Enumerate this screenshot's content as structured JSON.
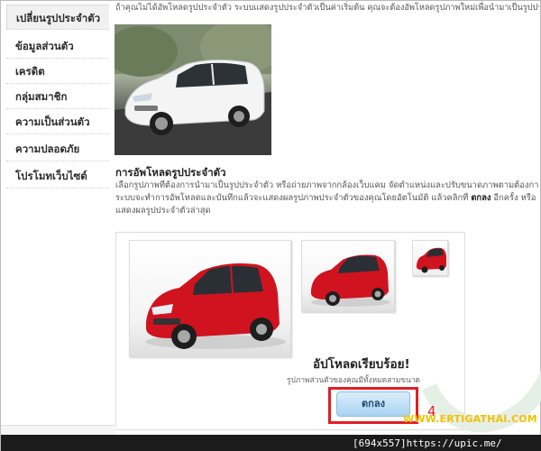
{
  "sidebar": {
    "items": [
      {
        "label": "เปลี่ยนรูปประจำตัว",
        "active": true
      },
      {
        "label": "ข้อมูลส่วนตัว"
      },
      {
        "label": "เครดิต"
      },
      {
        "label": "กลุ่มสมาชิก"
      },
      {
        "label": "ความเป็นส่วนตัว"
      },
      {
        "label": "ความปลอดภัย"
      },
      {
        "label": "โปรโมทเว็บไซต์"
      }
    ]
  },
  "intro": {
    "text": "ถ้าคุณไม่ได้อัพโหลดรูปประจำตัว ระบบแสดงรูปประจำตัวเป็นค่าเริ่มต้น คุณจะต้องอัพโหลดรูปภาพใหม่เพื่อนำมาเป็นรูปประจำตัว"
  },
  "upload": {
    "title": "การอัพโหลดรูปประจำตัว",
    "desc_line1": "เลือกรูปภาพที่ต้องการนำมาเป็นรูปประจำตัว หรือถ่ายภาพจากกล้องเว็บแคม จัดตำแหน่งและปรับขนาดภาพตามต้องการ",
    "desc_line2_pre": "ระบบจะทำการอัพโหลดและบันทึกแล้วจะแสดงผลรูปภาพประจำตัวของคุณโดยอัตโนมัติ แล้วคลิกที่ ",
    "desc_ok_word": "ตกลง",
    "desc_line2_post": " อีกครั้ง หรือ",
    "desc_line3": "แสดงผลรูปประจำตัวล่าสุด"
  },
  "result": {
    "title": "อัปโหลดเรียบร้อย!",
    "subtitle": "รูปภาพส่วนตัวของคุณมีทั้งหมดสามขนาด",
    "ok_label": "ตกลง"
  },
  "annotation": {
    "step_number": "4",
    "watermark": "WWW.ERTIGATHAI.COM"
  },
  "footer": {
    "upic_text": "[694x557]https://upic.me/"
  },
  "colors": {
    "highlight_red": "#e01e24",
    "car_red": "#d0131f",
    "button_blue": "#a9d3f3",
    "watermark_yellow": "#f2c200"
  }
}
